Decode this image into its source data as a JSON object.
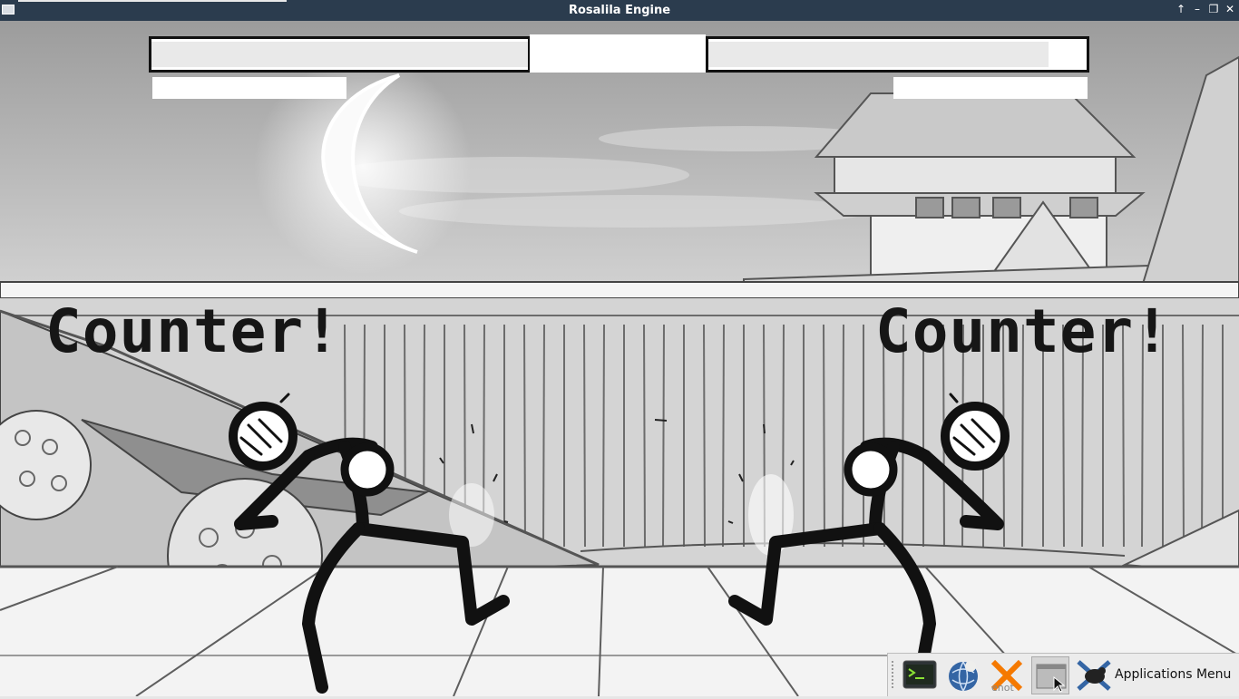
{
  "window": {
    "title": "Rosalila Engine",
    "controls": [
      "up-arrow",
      "minimize",
      "maximize",
      "close"
    ]
  },
  "hud": {
    "player1": {
      "health": 1.0
    },
    "player2": {
      "health": 0.9
    }
  },
  "messages": {
    "left": "Counter!",
    "right": "Counter!"
  },
  "taskbar": {
    "apps_menu_label": "Applications Menu",
    "launchers": [
      "terminal-icon",
      "web-browser-icon",
      "xfce-app-icon",
      "window-icon"
    ]
  },
  "colors": {
    "titlebar": "#2b3c4e",
    "ink": "#111111",
    "paper": "#e6e6e6"
  }
}
